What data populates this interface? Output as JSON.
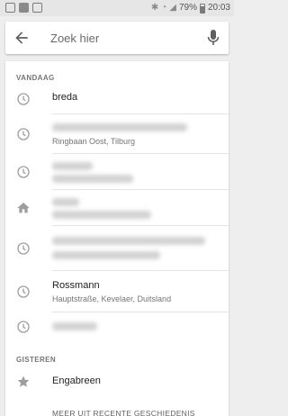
{
  "status_bar": {
    "battery": "79%",
    "time": "20:03",
    "icons": [
      "photo-icon",
      "gallery-icon",
      "gmail-icon",
      "bluetooth-icon",
      "wifi-icon",
      "signal-icon",
      "battery-icon"
    ]
  },
  "search": {
    "placeholder": "Zoek hier",
    "value": ""
  },
  "history": {
    "today_header": "VANDAAG",
    "yesterday_header": "GISTEREN",
    "today_items": [
      {
        "title": "breda",
        "subtitle": "",
        "icon": "clock-icon"
      },
      {
        "title": "",
        "subtitle": "Ringbaan Oost, Tilburg",
        "icon": "clock-icon"
      },
      {
        "title": "",
        "subtitle": "",
        "icon": "clock-icon"
      },
      {
        "title": "",
        "subtitle": "",
        "icon": "home-icon"
      },
      {
        "title": "",
        "subtitle": "",
        "icon": "clock-icon"
      },
      {
        "title": "Rossmann",
        "subtitle": "Hauptstraße, Kevelaer, Duitsland",
        "icon": "clock-icon"
      },
      {
        "title": "",
        "subtitle": "",
        "icon": "clock-icon"
      }
    ],
    "yesterday_items": [
      {
        "title": "Engabreen",
        "subtitle": "",
        "icon": "star-icon"
      }
    ],
    "more_link": "MEER UIT RECENTE GESCHIEDENIS"
  }
}
